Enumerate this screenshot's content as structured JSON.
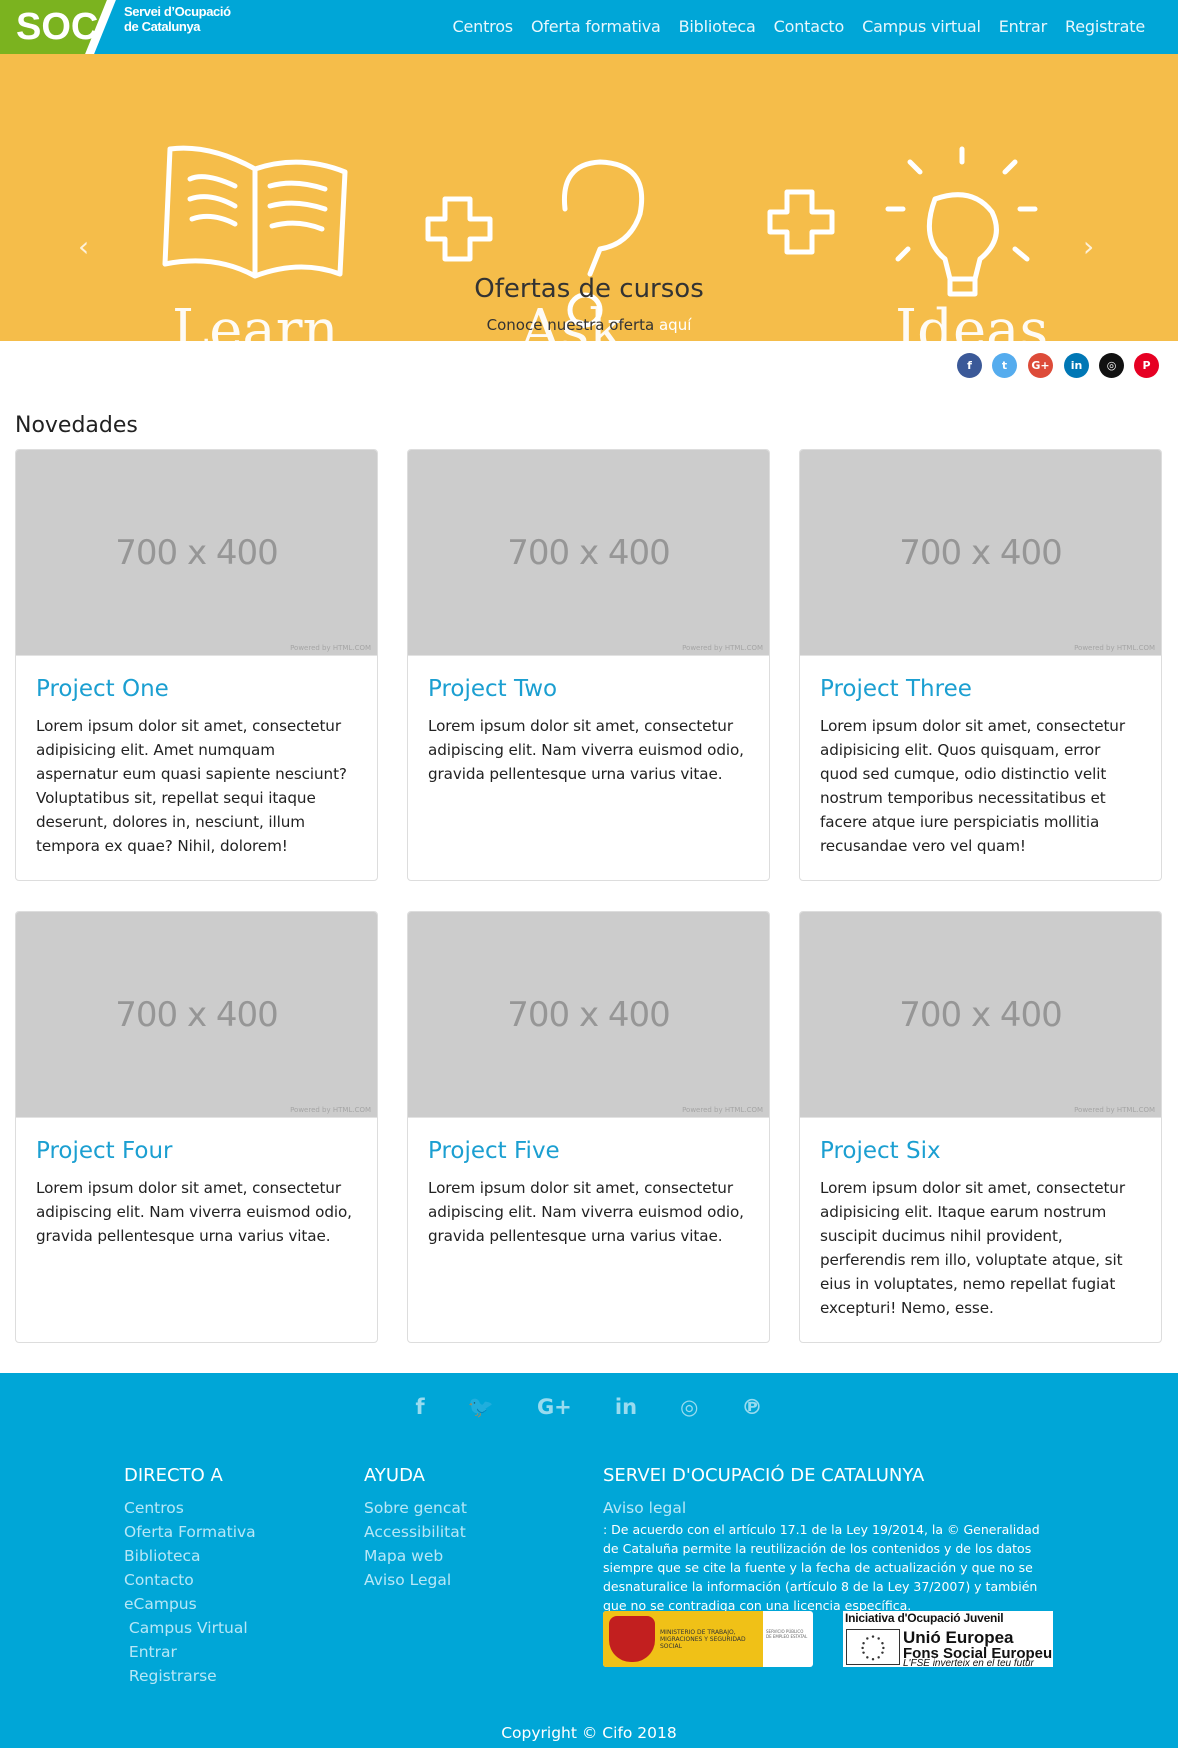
{
  "brand": {
    "short": "SOC",
    "line1": "Servei d’Ocupació",
    "line2": "de Catalunya"
  },
  "nav": {
    "items": [
      "Centros",
      "Oferta formativa",
      "Biblioteca",
      "Contacto",
      "Campus virtual",
      "Entrar",
      "Registrate"
    ]
  },
  "hero": {
    "art_words": [
      "Learn",
      "Ask",
      "Ideas"
    ],
    "title": "Ofertas de cursos",
    "subtitle_prefix": "Conoce nuestra oferta",
    "subtitle_link": "aquí",
    "prev_icon": "chevron-left-icon",
    "next_icon": "chevron-right-icon",
    "indicators": 4,
    "active_indicator": 3
  },
  "social_top": [
    {
      "icon": "facebook-icon",
      "glyph": "f",
      "color": "#3b5998"
    },
    {
      "icon": "twitter-icon",
      "glyph": "t",
      "color": "#55acee"
    },
    {
      "icon": "google-plus-icon",
      "glyph": "G+",
      "color": "#dd4b39"
    },
    {
      "icon": "linkedin-icon",
      "glyph": "in",
      "color": "#0077b5"
    },
    {
      "icon": "instagram-icon",
      "glyph": "◎",
      "color": "#111111"
    },
    {
      "icon": "pinterest-icon",
      "glyph": "P",
      "color": "#e60023"
    }
  ],
  "news": {
    "heading": "Novedades",
    "placeholder": "700 x 400",
    "powered": "Powered by HTML.COM",
    "cards": [
      {
        "title": "Project One",
        "text": "Lorem ipsum dolor sit amet, consectetur adipisicing elit. Amet numquam aspernatur eum quasi sapiente nesciunt? Voluptatibus sit, repellat sequi itaque deserunt, dolores in, nesciunt, illum tempora ex quae? Nihil, dolorem!"
      },
      {
        "title": "Project Two",
        "text": "Lorem ipsum dolor sit amet, consectetur adipiscing elit. Nam viverra euismod odio, gravida pellentesque urna varius vitae."
      },
      {
        "title": "Project Three",
        "text": "Lorem ipsum dolor sit amet, consectetur adipisicing elit. Quos quisquam, error quod sed cumque, odio distinctio velit nostrum temporibus necessitatibus et facere atque iure perspiciatis mollitia recusandae vero vel quam!"
      },
      {
        "title": "Project Four",
        "text": "Lorem ipsum dolor sit amet, consectetur adipiscing elit. Nam viverra euismod odio, gravida pellentesque urna varius vitae."
      },
      {
        "title": "Project Five",
        "text": "Lorem ipsum dolor sit amet, consectetur adipiscing elit. Nam viverra euismod odio, gravida pellentesque urna varius vitae."
      },
      {
        "title": "Project Six",
        "text": "Lorem ipsum dolor sit amet, consectetur adipisicing elit. Itaque earum nostrum suscipit ducimus nihil provident, perferendis rem illo, voluptate atque, sit eius in voluptates, nemo repellat fugiat excepturi! Nemo, esse."
      }
    ]
  },
  "footer": {
    "social": [
      {
        "icon": "facebook-icon",
        "glyph": "f"
      },
      {
        "icon": "twitter-icon",
        "glyph": "🐦"
      },
      {
        "icon": "google-plus-icon",
        "glyph": "G+"
      },
      {
        "icon": "linkedin-icon",
        "glyph": "in"
      },
      {
        "icon": "instagram-icon",
        "glyph": "◎"
      },
      {
        "icon": "pinterest-icon",
        "glyph": "℗"
      }
    ],
    "col1": {
      "title": "DIRECTO A",
      "links": [
        "Centros",
        "Oferta Formativa",
        "Biblioteca",
        "Contacto",
        "eCampus",
        " Campus Virtual",
        " Entrar",
        " Registrarse"
      ]
    },
    "col2": {
      "title": "AYUDA",
      "links": [
        "Sobre gencat",
        "Accessibilitat",
        "Mapa web",
        "Aviso Legal"
      ]
    },
    "col3": {
      "title": "SERVEI D'OCUPACIÓ DE CATALUNYA",
      "legal_link": "Aviso legal",
      "legal_text": " : De acuerdo con el artículo 17.1 de la Ley 19/2014, la © Generalidad de Cataluña permite la reutilización de los contenidos y de los datos siempre que se cite la fuente y la fecha de actualización y que no se desnaturalice la información (artículo 8 de la Ley 37/2007) y también que no se contradiga con una licencia específica."
    },
    "logo_ministry": {
      "text": "MINISTERIO DE TRABAJO, MIGRACIONES Y SEGURIDAD SOCIAL",
      "side": "SERVICIO PÚBLICO DE EMPLEO ESTATAL"
    },
    "logo_ue": {
      "line1": "Iniciativa d'Ocupació Juvenil",
      "line2": "Unió Europea",
      "line3": "Fons Social Europeu",
      "line4": "L'FSE inverteix en el teu futur"
    },
    "copyright": "Copyright © Cifo 2018"
  },
  "colors": {
    "nav": "#00a6d7",
    "logo_green": "#7bb31f",
    "hero": "#f5bd4a",
    "card_title": "#1b9fd1",
    "footer": "#00a6d7"
  }
}
